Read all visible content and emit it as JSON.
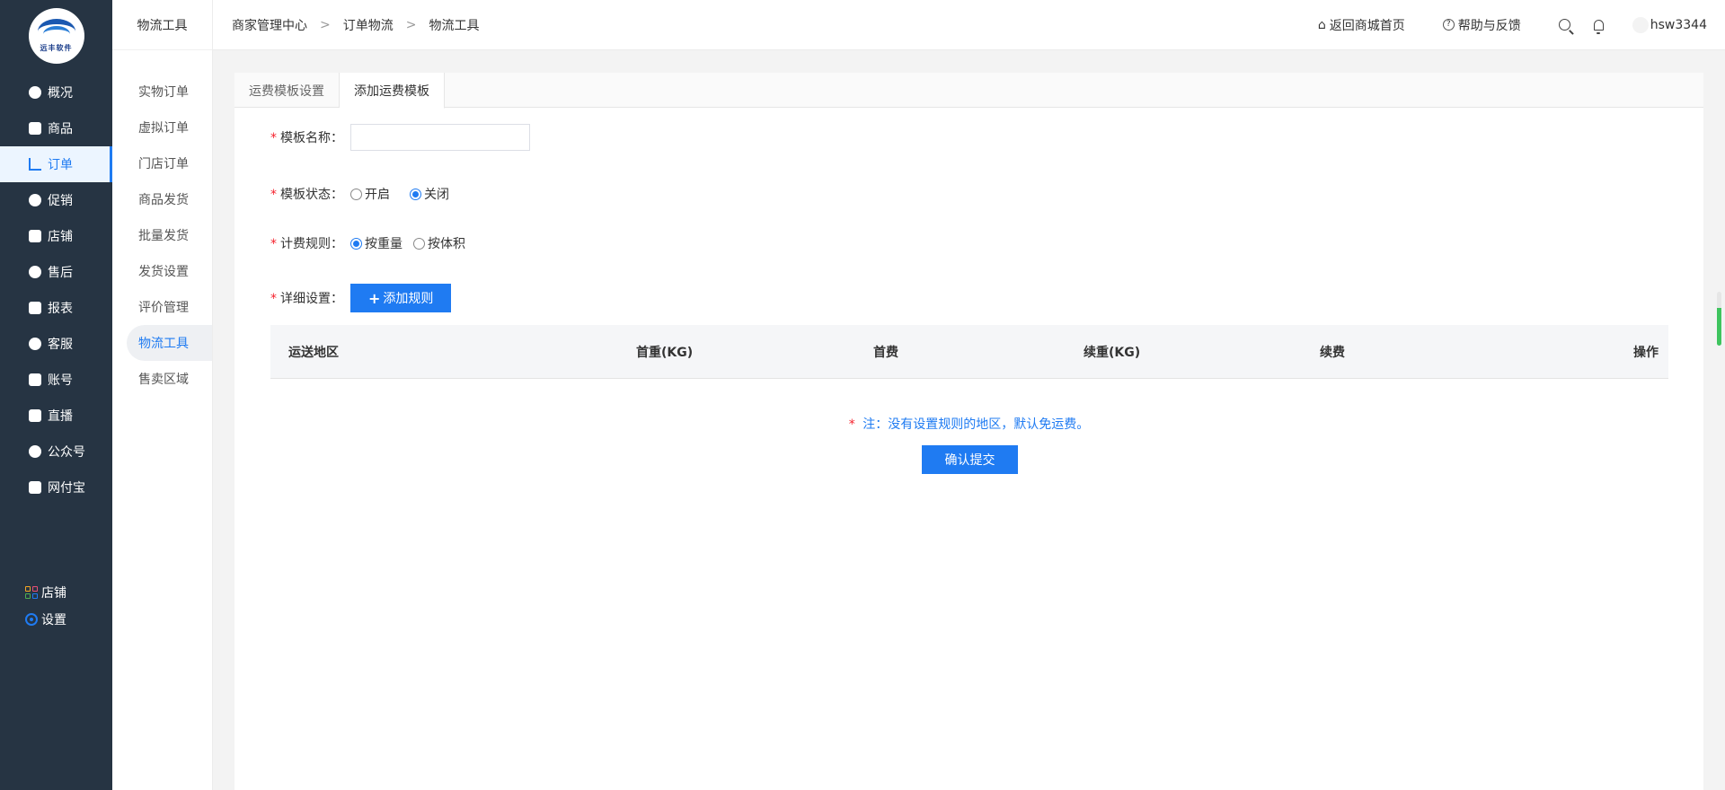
{
  "logo": {
    "text": "远丰软件"
  },
  "sidebar": {
    "items": [
      {
        "label": "概况",
        "icon": "dashboard-icon"
      },
      {
        "label": "商品",
        "icon": "bag-icon"
      },
      {
        "label": "订单",
        "icon": "bar-chart-icon"
      },
      {
        "label": "促销",
        "icon": "promo-icon"
      },
      {
        "label": "店铺",
        "icon": "store-icon"
      },
      {
        "label": "售后",
        "icon": "aftersale-icon"
      },
      {
        "label": "报表",
        "icon": "report-icon"
      },
      {
        "label": "客服",
        "icon": "service-icon"
      },
      {
        "label": "账号",
        "icon": "card-icon"
      },
      {
        "label": "直播",
        "icon": "live-icon"
      },
      {
        "label": "公众号",
        "icon": "check-badge-icon"
      },
      {
        "label": "网付宝",
        "icon": "shield-icon"
      }
    ],
    "active_index": 2,
    "bottom": {
      "shop_label": "店铺",
      "settings_label": "设置"
    }
  },
  "subbar": {
    "title": "物流工具",
    "items": [
      "实物订单",
      "虚拟订单",
      "门店订单",
      "商品发货",
      "批量发货",
      "发货设置",
      "评价管理",
      "物流工具",
      "售卖区域"
    ],
    "active_index": 7
  },
  "header": {
    "breadcrumb": [
      "商家管理中心",
      "订单物流",
      "物流工具"
    ],
    "home_link": "返回商城首页",
    "help_link": "帮助与反馈",
    "username": "hsw3344"
  },
  "tabs": [
    "运费模板设置",
    "添加运费模板"
  ],
  "active_tab": 1,
  "form": {
    "name_label": "模板名称：",
    "name_value": "",
    "status_label": "模板状态：",
    "status_options": [
      "开启",
      "关闭"
    ],
    "status_selected": "关闭",
    "rule_label": "计费规则：",
    "rule_options": [
      "按重量",
      "按体积"
    ],
    "rule_selected": "按重量",
    "detail_label": "详细设置：",
    "add_rule_button": "添加规则"
  },
  "table": {
    "columns": [
      "运送地区",
      "首重(KG)",
      "首费",
      "续重(KG)",
      "续费",
      "操作"
    ],
    "rows": []
  },
  "note": "注：没有设置规则的地区，默认免运费。",
  "submit_button": "确认提交",
  "colors": {
    "primary": "#1f7bf2",
    "sidebar_bg": "#263443",
    "required": "#f5222d"
  }
}
